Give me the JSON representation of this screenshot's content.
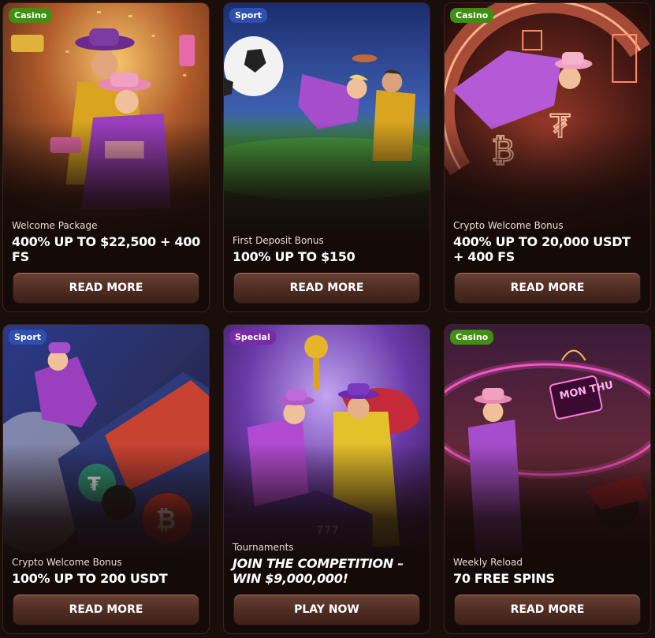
{
  "promotions": [
    {
      "badge": "Casino",
      "badge_color": "#3f8f12",
      "category": "Welcome Package",
      "headline": "400% UP TO $22,500 + 400 FS",
      "button": "READ MORE",
      "art": "cowboy-duo-casino"
    },
    {
      "badge": "Sport",
      "badge_color": "#2d4fae",
      "category": "First Deposit Bonus",
      "headline": "100% UP TO $150",
      "button": "READ MORE",
      "art": "soccer-kick"
    },
    {
      "badge": "Casino",
      "badge_color": "#3f8f12",
      "category": "Crypto Welcome Bonus",
      "headline": "400% UP TO 20,000 USDT + 400 FS",
      "button": "READ MORE",
      "art": "crypto-wheel"
    },
    {
      "badge": "Sport",
      "badge_color": "#2d4fae",
      "category": "Crypto Welcome Bonus",
      "headline": "100% UP TO 200 USDT",
      "button": "READ MORE",
      "art": "race-car"
    },
    {
      "badge": "Special",
      "badge_color": "#7a2aa8",
      "category": "Tournaments",
      "headline": "JOIN THE COMPETITION – WIN $9,000,000!",
      "button": "PLAY NOW",
      "art": "trophy-duo"
    },
    {
      "badge": "Casino",
      "badge_color": "#3f8f12",
      "category": "Weekly Reload",
      "headline": "70 FREE SPINS",
      "button": "READ MORE",
      "art": "neon-lasso"
    }
  ],
  "neon_sign": "MON THU"
}
